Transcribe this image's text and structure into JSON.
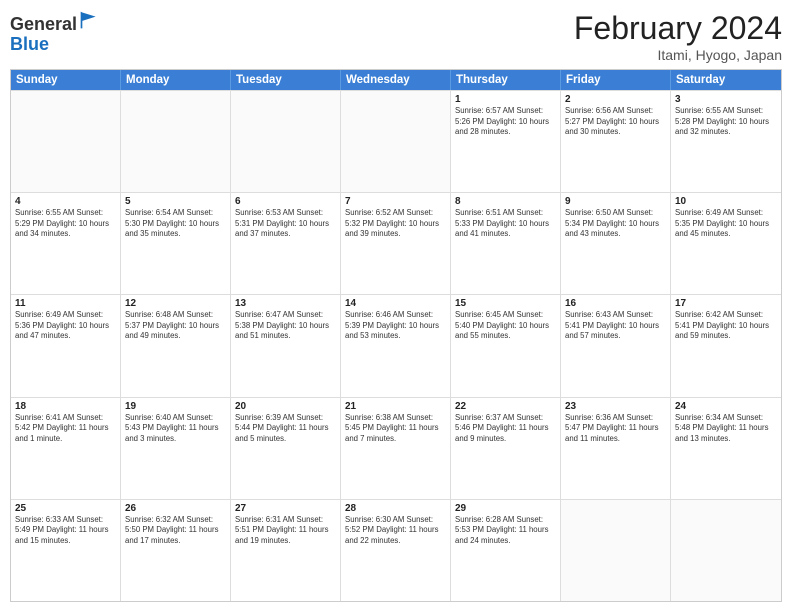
{
  "header": {
    "logo_general": "General",
    "logo_blue": "Blue",
    "title": "February 2024",
    "subtitle": "Itami, Hyogo, Japan"
  },
  "weekdays": [
    "Sunday",
    "Monday",
    "Tuesday",
    "Wednesday",
    "Thursday",
    "Friday",
    "Saturday"
  ],
  "weeks": [
    [
      {
        "day": "",
        "empty": true
      },
      {
        "day": "",
        "empty": true
      },
      {
        "day": "",
        "empty": true
      },
      {
        "day": "",
        "empty": true
      },
      {
        "day": "1",
        "info": "Sunrise: 6:57 AM\nSunset: 5:26 PM\nDaylight: 10 hours\nand 28 minutes."
      },
      {
        "day": "2",
        "info": "Sunrise: 6:56 AM\nSunset: 5:27 PM\nDaylight: 10 hours\nand 30 minutes."
      },
      {
        "day": "3",
        "info": "Sunrise: 6:55 AM\nSunset: 5:28 PM\nDaylight: 10 hours\nand 32 minutes."
      }
    ],
    [
      {
        "day": "4",
        "info": "Sunrise: 6:55 AM\nSunset: 5:29 PM\nDaylight: 10 hours\nand 34 minutes."
      },
      {
        "day": "5",
        "info": "Sunrise: 6:54 AM\nSunset: 5:30 PM\nDaylight: 10 hours\nand 35 minutes."
      },
      {
        "day": "6",
        "info": "Sunrise: 6:53 AM\nSunset: 5:31 PM\nDaylight: 10 hours\nand 37 minutes."
      },
      {
        "day": "7",
        "info": "Sunrise: 6:52 AM\nSunset: 5:32 PM\nDaylight: 10 hours\nand 39 minutes."
      },
      {
        "day": "8",
        "info": "Sunrise: 6:51 AM\nSunset: 5:33 PM\nDaylight: 10 hours\nand 41 minutes."
      },
      {
        "day": "9",
        "info": "Sunrise: 6:50 AM\nSunset: 5:34 PM\nDaylight: 10 hours\nand 43 minutes."
      },
      {
        "day": "10",
        "info": "Sunrise: 6:49 AM\nSunset: 5:35 PM\nDaylight: 10 hours\nand 45 minutes."
      }
    ],
    [
      {
        "day": "11",
        "info": "Sunrise: 6:49 AM\nSunset: 5:36 PM\nDaylight: 10 hours\nand 47 minutes."
      },
      {
        "day": "12",
        "info": "Sunrise: 6:48 AM\nSunset: 5:37 PM\nDaylight: 10 hours\nand 49 minutes."
      },
      {
        "day": "13",
        "info": "Sunrise: 6:47 AM\nSunset: 5:38 PM\nDaylight: 10 hours\nand 51 minutes."
      },
      {
        "day": "14",
        "info": "Sunrise: 6:46 AM\nSunset: 5:39 PM\nDaylight: 10 hours\nand 53 minutes."
      },
      {
        "day": "15",
        "info": "Sunrise: 6:45 AM\nSunset: 5:40 PM\nDaylight: 10 hours\nand 55 minutes."
      },
      {
        "day": "16",
        "info": "Sunrise: 6:43 AM\nSunset: 5:41 PM\nDaylight: 10 hours\nand 57 minutes."
      },
      {
        "day": "17",
        "info": "Sunrise: 6:42 AM\nSunset: 5:41 PM\nDaylight: 10 hours\nand 59 minutes."
      }
    ],
    [
      {
        "day": "18",
        "info": "Sunrise: 6:41 AM\nSunset: 5:42 PM\nDaylight: 11 hours\nand 1 minute."
      },
      {
        "day": "19",
        "info": "Sunrise: 6:40 AM\nSunset: 5:43 PM\nDaylight: 11 hours\nand 3 minutes."
      },
      {
        "day": "20",
        "info": "Sunrise: 6:39 AM\nSunset: 5:44 PM\nDaylight: 11 hours\nand 5 minutes."
      },
      {
        "day": "21",
        "info": "Sunrise: 6:38 AM\nSunset: 5:45 PM\nDaylight: 11 hours\nand 7 minutes."
      },
      {
        "day": "22",
        "info": "Sunrise: 6:37 AM\nSunset: 5:46 PM\nDaylight: 11 hours\nand 9 minutes."
      },
      {
        "day": "23",
        "info": "Sunrise: 6:36 AM\nSunset: 5:47 PM\nDaylight: 11 hours\nand 11 minutes."
      },
      {
        "day": "24",
        "info": "Sunrise: 6:34 AM\nSunset: 5:48 PM\nDaylight: 11 hours\nand 13 minutes."
      }
    ],
    [
      {
        "day": "25",
        "info": "Sunrise: 6:33 AM\nSunset: 5:49 PM\nDaylight: 11 hours\nand 15 minutes."
      },
      {
        "day": "26",
        "info": "Sunrise: 6:32 AM\nSunset: 5:50 PM\nDaylight: 11 hours\nand 17 minutes."
      },
      {
        "day": "27",
        "info": "Sunrise: 6:31 AM\nSunset: 5:51 PM\nDaylight: 11 hours\nand 19 minutes."
      },
      {
        "day": "28",
        "info": "Sunrise: 6:30 AM\nSunset: 5:52 PM\nDaylight: 11 hours\nand 22 minutes."
      },
      {
        "day": "29",
        "info": "Sunrise: 6:28 AM\nSunset: 5:53 PM\nDaylight: 11 hours\nand 24 minutes."
      },
      {
        "day": "",
        "empty": true
      },
      {
        "day": "",
        "empty": true
      }
    ]
  ]
}
